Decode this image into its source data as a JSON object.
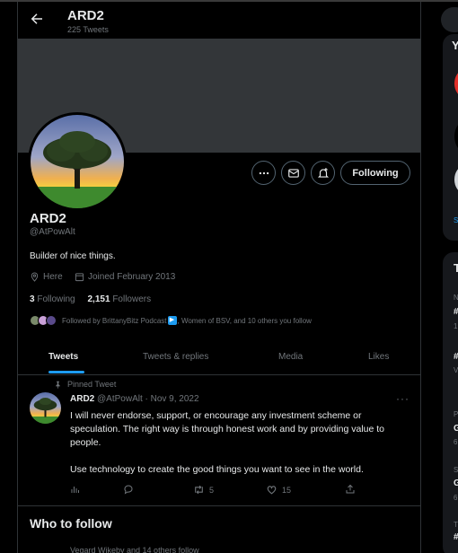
{
  "header": {
    "name": "ARD2",
    "tweet_count": "225 Tweets"
  },
  "profile": {
    "name": "ARD2",
    "handle": "@AtPowAlt",
    "bio": "Builder of nice things.",
    "location": "Here",
    "joined": "Joined February 2013",
    "following_count": "3",
    "following_label": "Following",
    "followers_count": "2,151",
    "followers_label": "Followers",
    "followed_by_prefix": "Followed by BrittanyBitz Podcast",
    "followed_by_suffix": ", Women of BSV, and 10 others you follow",
    "following_button": "Following"
  },
  "tabs": [
    "Tweets",
    "Tweets & replies",
    "Media",
    "Likes"
  ],
  "tweet": {
    "pinned_label": "Pinned Tweet",
    "author": "ARD2",
    "handle_date": "@AtPowAlt · Nov 9, 2022",
    "text_p1": "I will never endorse, support, or encourage any investment scheme or speculation. The right way is through honest work and by providing value to people.",
    "text_p2": "Use technology to create the good things you want to see in the world.",
    "retweets": "5",
    "likes": "15"
  },
  "who_to_follow": {
    "title": "Who to follow",
    "subtitle": "Vegard Wikeby and 14 others follow"
  },
  "colors": {
    "accent": "#1d9bf0",
    "background": "#000000",
    "muted": "#71767b",
    "border": "#2f3336"
  }
}
